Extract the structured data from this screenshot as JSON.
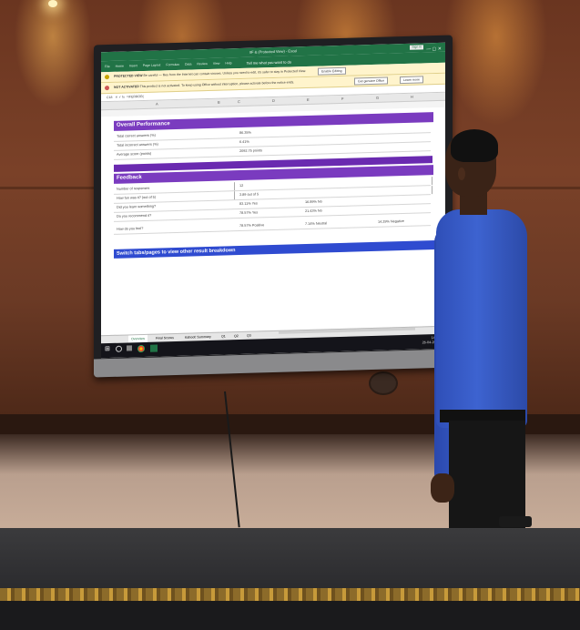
{
  "excel": {
    "window_title": "IIF & (Protected View) - Excel",
    "sign_in": "Sign in",
    "tabs": [
      "File",
      "Home",
      "Insert",
      "Page Layout",
      "Formulas",
      "Data",
      "Review",
      "View",
      "Help"
    ],
    "tell_me": "Tell me what you want to do",
    "protected_view": {
      "label": "PROTECTED VIEW",
      "message": "Be careful — files from the Internet can contain viruses. Unless you need to edit, it's safer to stay in Protected View.",
      "button": "Enable Editing"
    },
    "activation": {
      "label": "NOT ACTIVATED",
      "message": "This product is not activated. To keep using Office without interruption, please activate before the notice ends.",
      "button1": "Get genuine Office",
      "button2": "Learn more"
    },
    "name_box": "C18",
    "formula": "=IFERROR(",
    "columns": [
      "A",
      "B",
      "C",
      "D",
      "E",
      "F",
      "G",
      "H"
    ],
    "sections": [
      {
        "title": "Overall Performance",
        "rows": [
          {
            "label": "Total correct answers (%)",
            "v1": "86.35%"
          },
          {
            "label": "Total incorrect answers (%)",
            "v1": "6.41%"
          },
          {
            "label": "Average score (points)",
            "v1": "2092.75 points"
          }
        ]
      },
      {
        "title": "Feedback",
        "rows": [
          {
            "label": "Number of responses",
            "v1": "12"
          },
          {
            "label": "How fun was it? (out of 5)",
            "v1": "3.89 out of 5"
          },
          {
            "label": "Did you learn something?",
            "v1": "83.11% Yes",
            "v2": "16.89% No"
          },
          {
            "label": "Do you recommend it?",
            "v1": "78.57% Yes",
            "v2": "21.43% No"
          },
          {
            "label": "How do you feel?",
            "v1": "78.57% Positive",
            "v2": "7.14% Neutral",
            "v3": "14.29% Negative"
          }
        ]
      }
    ],
    "switch_bar": "Switch tabs/pages to view other result breakdown",
    "sheet_tabs": [
      "Overview",
      "Final Scores",
      "Kahoot! Summary",
      "Q1",
      "Q2",
      "Q3"
    ],
    "clock": {
      "time": "14:01",
      "date": "26-04-2023"
    }
  },
  "colors": {
    "excel_green": "#217346",
    "section_purple": "#7a3bbf",
    "switch_blue": "#2f4bd0"
  }
}
